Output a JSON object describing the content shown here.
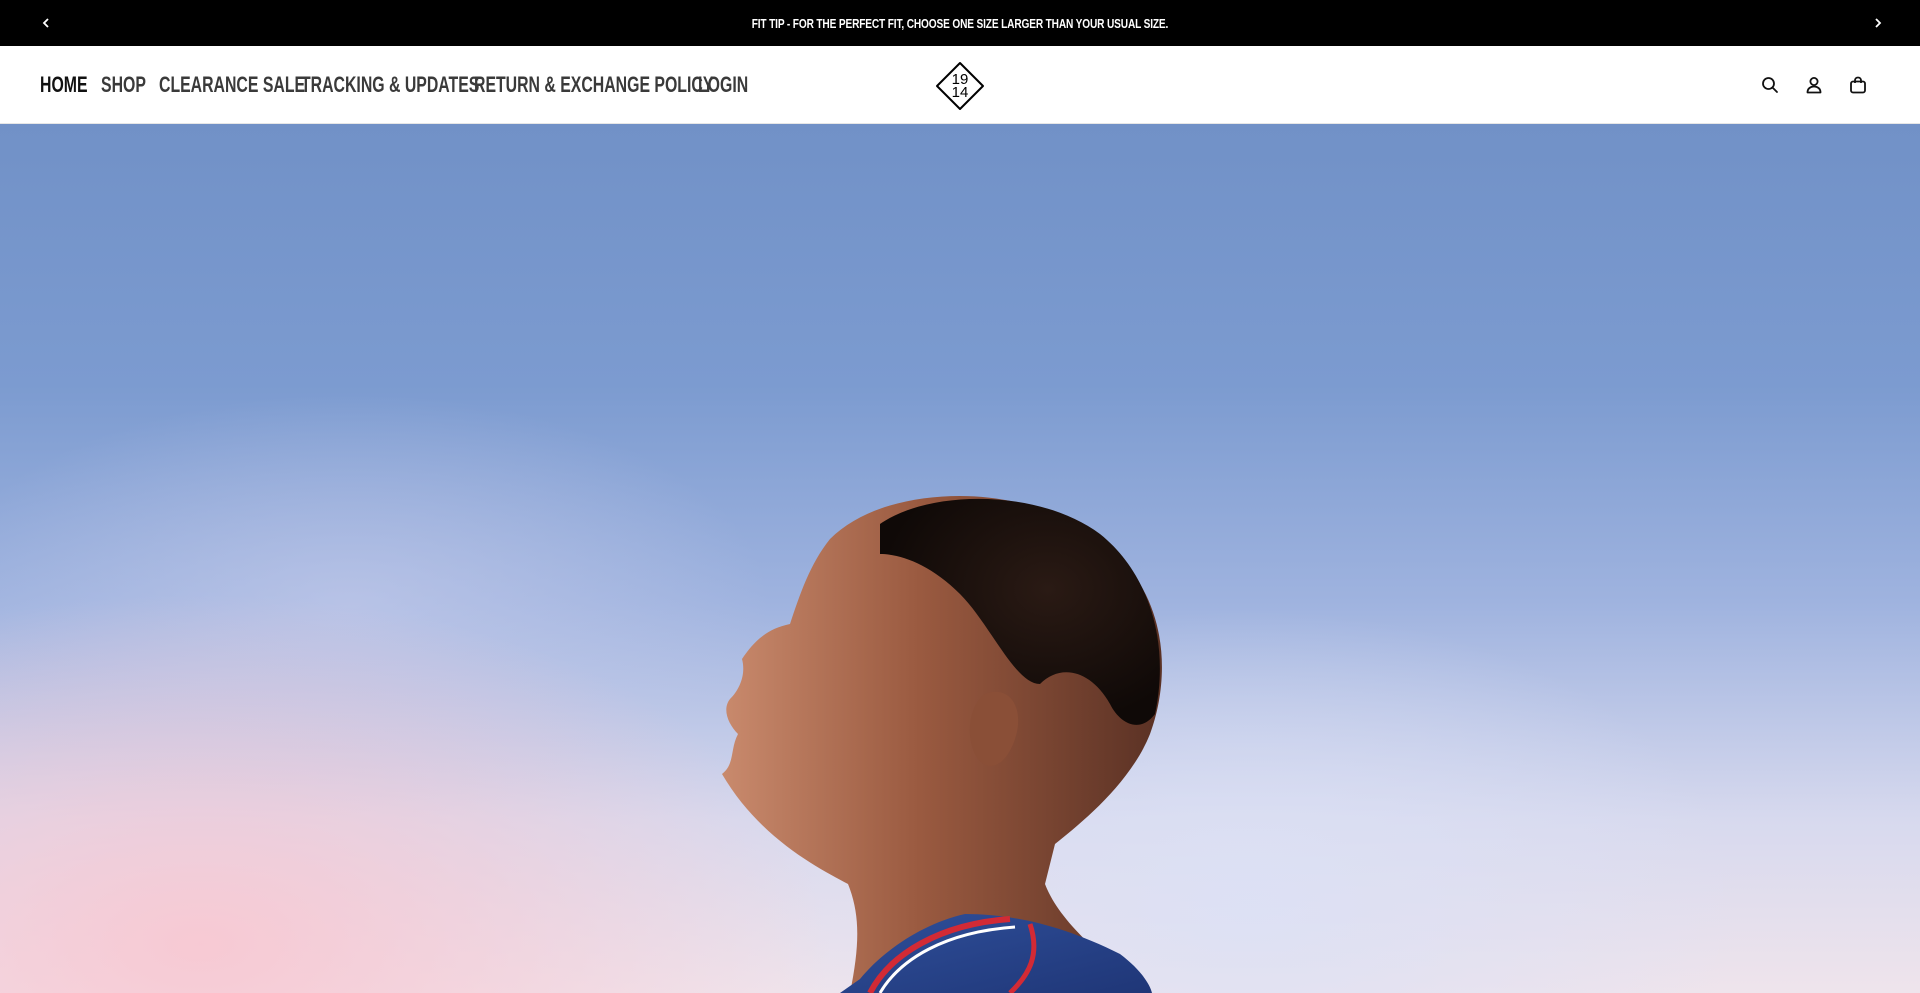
{
  "announcement": {
    "text": "FIT TIP - FOR THE PERFECT FIT, CHOOSE ONE SIZE LARGER THAN YOUR USUAL SIZE.",
    "prev_icon": "chevron-left-icon",
    "next_icon": "chevron-right-icon"
  },
  "nav": {
    "items": [
      {
        "label": "HOME"
      },
      {
        "label": "SHOP"
      },
      {
        "label": "CLEARANCE SALE"
      },
      {
        "label": "TRACKING & UPDATES"
      },
      {
        "label": "RETURN & EXCHANGE POLICY"
      },
      {
        "label": "LOGIN"
      }
    ]
  },
  "logo": {
    "top": "19",
    "bottom": "14"
  },
  "header_icons": [
    "search-icon",
    "account-icon",
    "cart-bag-icon"
  ],
  "colors": {
    "announcement_bg": "#000000",
    "nav_text": "#3a3a3a",
    "sky_top": "#7191c7",
    "sky_pink": "#f8c8d2"
  }
}
